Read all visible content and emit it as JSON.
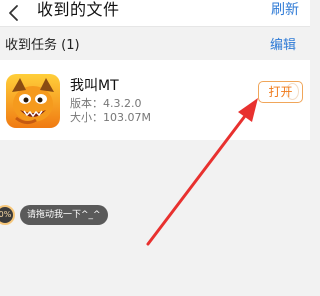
{
  "header": {
    "back_icon": "chevron-left-icon",
    "title": "收到的文件",
    "refresh_label": "刷新"
  },
  "section": {
    "title": "收到任务 (1)",
    "edit_label": "编辑"
  },
  "file_item": {
    "icon": "game-character-icon",
    "name": "我叫MT",
    "version": "版本：4.3.2.0",
    "size": "大小：103.07M",
    "open_label": "打开"
  },
  "floating_ball": {
    "badge": "0%",
    "tooltip": "请拖动我一下^_^"
  },
  "colors": {
    "accent_blue": "#2f7bd6",
    "open_orange": "#f07a1a",
    "annotation_arrow": "#e8312f"
  }
}
